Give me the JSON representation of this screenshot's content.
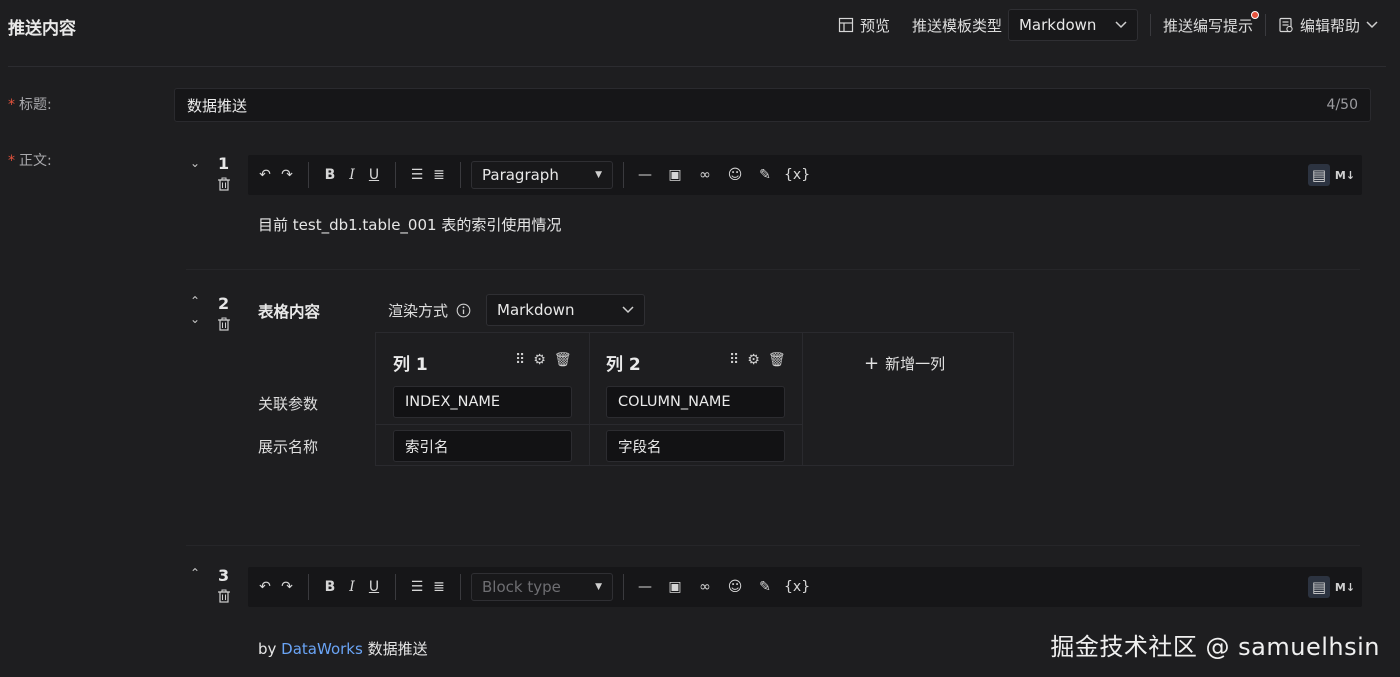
{
  "header": {
    "title": "推送内容",
    "preview_label": "预览",
    "template_type_label": "推送模板类型",
    "template_type_value": "Markdown",
    "writing_tips_label": "推送编写提示",
    "edit_help_label": "编辑帮助"
  },
  "form": {
    "title_label": "标题:",
    "title_value": "数据推送",
    "title_count": "4/50",
    "body_label": "正文:"
  },
  "blocks": [
    {
      "number": "1",
      "block_select": "Paragraph",
      "content": "目前 test_db1.table_001 表的索引使用情况"
    },
    {
      "number": "2",
      "section_label": "表格内容",
      "render_label": "渲染方式",
      "render_value": "Markdown",
      "row_labels": [
        "关联参数",
        "展示名称"
      ],
      "columns": [
        {
          "title": "列 1",
          "param": "INDEX_NAME",
          "display": "索引名"
        },
        {
          "title": "列 2",
          "param": "COLUMN_NAME",
          "display": "字段名"
        }
      ],
      "add_column_label": "新增一列"
    },
    {
      "number": "3",
      "block_select_placeholder": "Block type",
      "content_prefix": "by ",
      "content_link": "DataWorks",
      "content_suffix": " 数据推送"
    }
  ],
  "toolbar": {
    "variable_label": "{x}",
    "md_label": "M↓"
  },
  "watermark": "掘金技术社区 @ samuelhsin",
  "colors": {
    "background": "#1e1e20",
    "required": "#e5533d",
    "link": "#6aa4f5",
    "notification_dot": "#e5533d"
  }
}
